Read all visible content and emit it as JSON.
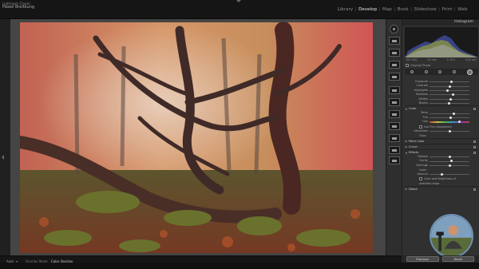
{
  "app": {
    "brand_line1": "Lightroom Classic",
    "brand_line2": "Pawel Breitkung"
  },
  "modules": [
    {
      "label": "Library",
      "active": false
    },
    {
      "label": "Develop",
      "active": true
    },
    {
      "label": "Map",
      "active": false
    },
    {
      "label": "Book",
      "active": false
    },
    {
      "label": "Slideshow",
      "active": false
    },
    {
      "label": "Print",
      "active": false
    },
    {
      "label": "Web",
      "active": false
    }
  ],
  "panel": {
    "histogram_title": "Histogram",
    "hist_readout": [
      "ISO 400",
      "24 mm",
      "f / 8.0",
      "1/25 sec"
    ],
    "original_photo_label": "Original Photo",
    "tone_sliders": [
      {
        "label": "Exposure",
        "value": "",
        "pos": 0.55
      },
      {
        "label": "Contrast",
        "value": "",
        "pos": 0.5
      },
      {
        "label": "Highlights",
        "value": "",
        "pos": 0.45
      },
      {
        "label": "Shadows",
        "value": "",
        "pos": 0.58
      },
      {
        "label": "Whites",
        "value": "",
        "pos": 0.52
      },
      {
        "label": "Blacks",
        "value": "",
        "pos": 0.48
      }
    ],
    "color_section": "Color",
    "color_sliders": [
      {
        "label": "Temp",
        "value": "",
        "pos": 0.6,
        "grad": false
      },
      {
        "label": "Tint",
        "value": "",
        "pos": 0.52,
        "grad": false
      },
      {
        "label": "Hue",
        "value": "",
        "pos": 0.75,
        "grad": true
      }
    ],
    "use_fine_adjustment": "Use Fine Adjustment",
    "saturation": {
      "label": "Saturation",
      "value": "",
      "pos": 0.5
    },
    "color_label": "Color",
    "section_point_color": "Point Color",
    "section_curve": "Curve",
    "section_effects": "Effects",
    "effects_sliders": [
      {
        "label": "Dehaze",
        "value": "",
        "pos": 0.5
      },
      {
        "label": "Clarity",
        "value": "",
        "pos": 0.55
      },
      {
        "label": "Defringe",
        "value": "",
        "pos": 0.5
      }
    ],
    "grain_label": "Grain",
    "grain_sliders": [
      {
        "label": "Amount",
        "value": "",
        "pos": 0.3
      }
    ],
    "show_edge_label": "Color and Brightness of",
    "show_edge_label2": "selected range",
    "section_detail": "Detail",
    "previous_button": "Previous",
    "reset_button": "Reset"
  },
  "bottom": {
    "auto_label": "Auto",
    "modes": [
      {
        "label": "Overlay Mode",
        "active": false
      },
      {
        "label": "Color Overlay",
        "active": true
      }
    ]
  },
  "colors": {
    "panel_bg": "#303030",
    "top_bg": "#151515",
    "canvas_bg": "#454545"
  }
}
